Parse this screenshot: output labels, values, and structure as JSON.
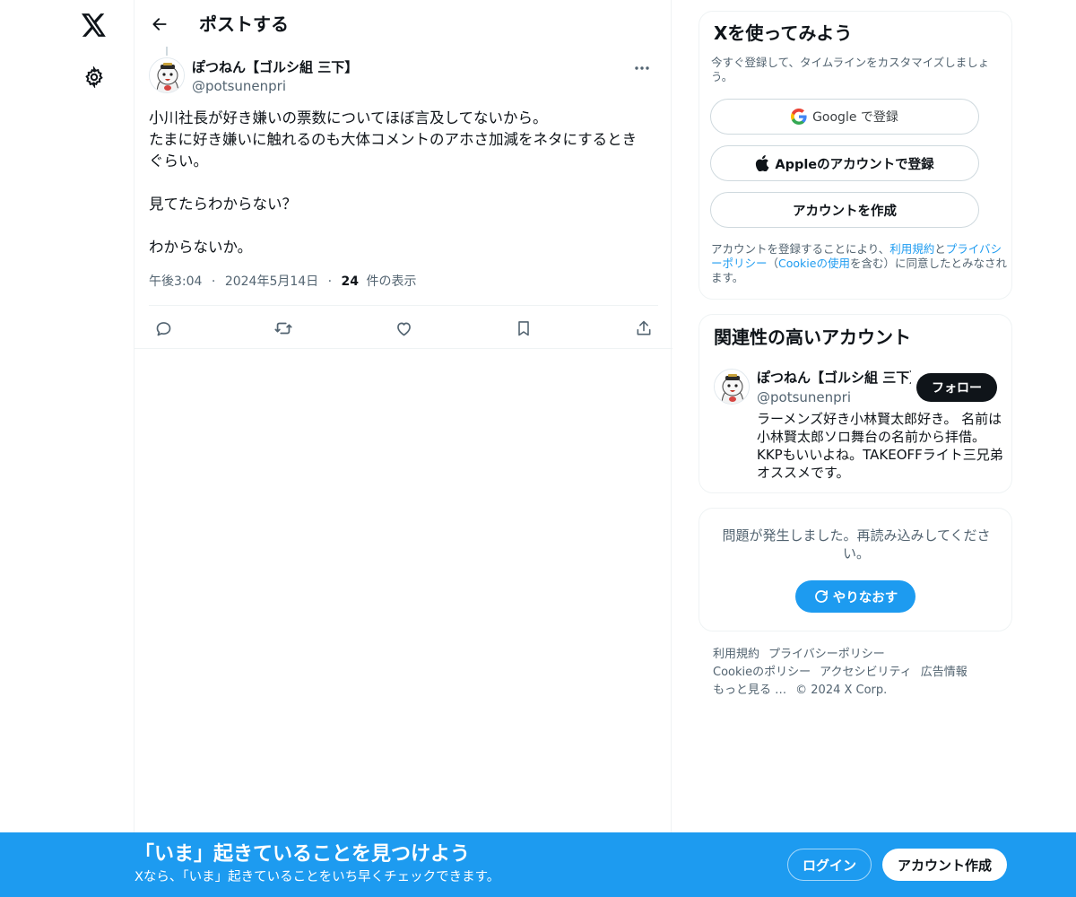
{
  "nav": {
    "logo_icon": "x-logo-icon",
    "settings_icon": "gear-icon"
  },
  "header": {
    "title": "ポストする",
    "back_icon": "arrow-left-icon"
  },
  "post": {
    "author_name": "ぽつねん【ゴルシ組 三下】",
    "author_handle": "@potsunenpri",
    "text": "小川社長が好き嫌いの票数についてほぼ言及してないから。\nたまに好き嫌いに触れるのも大体コメントのアホさ加減をネタにするとき\nぐらい。\n\n見てたらわからない？\n\nわからないか。",
    "time": "午後3:04",
    "separator": "·",
    "date": "2024年5月14日",
    "views_count": "24",
    "views_label": "件の表示",
    "actions": [
      "reply-icon",
      "repost-icon",
      "like-icon",
      "bookmark-icon",
      "share-icon"
    ]
  },
  "signup_card": {
    "title": "Xを使ってみよう",
    "subtitle": "今すぐ登録して、タイムラインをカスタマイズしましょう。",
    "google_label": "Google で登録",
    "apple_label": "Appleのアカウントで登録",
    "create_label": "アカウントを作成",
    "terms_pre": "アカウントを登録することにより、",
    "terms_link1": "利用規約",
    "terms_and": "と",
    "terms_link2": "プライバシーポリシー",
    "terms_paren_open": "（",
    "terms_link3": "Cookieの使用",
    "terms_post": "を含む）に同意したとみなされます。"
  },
  "related": {
    "title": "関連性の高いアカウント",
    "name": "ぽつねん【ゴルシ組 三下】",
    "handle": "@potsunenpri",
    "follow_label": "フォロー",
    "bio": "ラーメンズ好き小林賢太郎好き。 名前は小林賢太郎ソロ舞台の名前から拝借。 KKPもいいよね。TAKEOFFライト三兄弟オススメです。"
  },
  "error_card": {
    "message": "問題が発生しました。再読み込みしてください。",
    "retry_label": "やりなおす"
  },
  "footer": {
    "links": [
      "利用規約",
      "プライバシーポリシー",
      "Cookieのポリシー",
      "アクセシビリティ",
      "広告情報",
      "もっと見る …"
    ],
    "copyright": "© 2024 X Corp."
  },
  "banner": {
    "title": "「いま」起きていることを見つけよう",
    "subtitle": "Xなら、「いま」起きていることをいち早くチェックできます。",
    "login_label": "ログイン",
    "signup_label": "アカウント作成"
  },
  "colors": {
    "accent": "#1d9bf0",
    "text": "#0f1419",
    "muted": "#536471",
    "border": "#eff3f4"
  }
}
